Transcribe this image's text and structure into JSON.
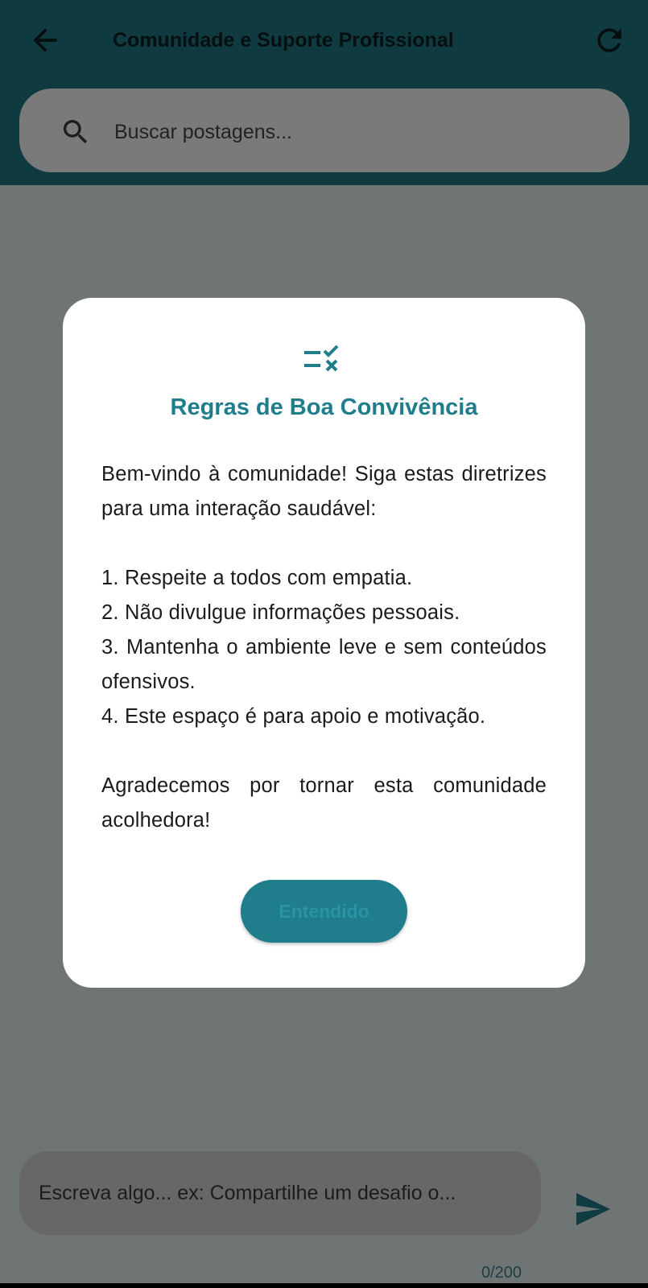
{
  "header": {
    "title": "Comunidade e Suporte Profissional",
    "back_icon": "arrow-back-icon",
    "refresh_icon": "refresh-icon"
  },
  "search": {
    "placeholder": "Buscar postagens...",
    "icon": "search-icon"
  },
  "dialog": {
    "icon": "rule-checklist-icon",
    "title": "Regras de Boa Convivência",
    "intro": "Bem-vindo à comunidade! Siga estas diretrizes para uma interação saudável:",
    "rules": [
      "1. Respeite a todos com empatia.",
      "2. Não divulgue informações pessoais.",
      "3. Mantenha o ambiente leve e sem conteúdos ofensivos.",
      "4. Este espaço é para apoio e motivação."
    ],
    "closing": "Agradecemos por tornar esta comunidade acolhedora!",
    "button_label": "Entendido"
  },
  "composer": {
    "placeholder": "Escreva algo... ex: Compartilhe um desafio o...",
    "counter": "0/200",
    "send_icon": "send-icon"
  },
  "colors": {
    "accent": "#1f7d8c",
    "header_bg_dimmed": "#0f3a40",
    "scrim": "#6f7474"
  }
}
